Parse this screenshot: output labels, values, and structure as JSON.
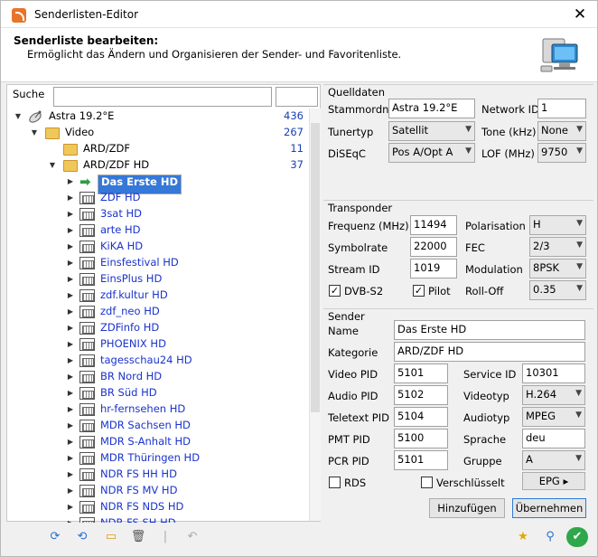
{
  "window": {
    "title": "Senderlisten-Editor",
    "close_glyph": "✕"
  },
  "header": {
    "title": "Senderliste bearbeiten:",
    "subtitle": "Ermöglicht das Ändern und Organisieren der Sender- und Favoritenliste."
  },
  "search": {
    "label": "Suche",
    "value": "",
    "value2": ""
  },
  "tree": {
    "satellite": {
      "label": "Astra 19.2°E",
      "count": "436"
    },
    "video": {
      "label": "Video",
      "count": "267"
    },
    "folders": [
      {
        "label": "ARD/ZDF",
        "count": "11"
      },
      {
        "label": "ARD/ZDF HD",
        "count": "37"
      }
    ],
    "channels": [
      "Das Erste HD",
      "ZDF HD",
      "3sat HD",
      "arte HD",
      "KiKA HD",
      "Einsfestival HD",
      "EinsPlus HD",
      "zdf.kultur HD",
      "zdf_neo HD",
      "ZDFinfo HD",
      "PHOENIX HD",
      "tagesschau24 HD",
      "BR Nord HD",
      "BR Süd HD",
      "hr-fernsehen HD",
      "MDR Sachsen HD",
      "MDR S-Anhalt HD",
      "MDR Thüringen HD",
      "NDR FS HH HD",
      "NDR FS MV HD",
      "NDR FS NDS HD",
      "NDR FS SH HD"
    ]
  },
  "quelldaten": {
    "title": "Quelldaten",
    "stammordner_label": "Stammordner",
    "stammordner_value": "Astra 19.2°E",
    "networkid_label": "Network ID",
    "networkid_value": "1",
    "tunertyp_label": "Tunertyp",
    "tunertyp_value": "Satellit",
    "tone_label": "Tone (kHz)",
    "tone_value": "None",
    "diseqc_label": "DiSEqC",
    "diseqc_value": "Pos A/Opt A",
    "lof_label": "LOF  (MHz)",
    "lof_value": "9750"
  },
  "transponder": {
    "title": "Transponder",
    "frequenz_label": "Frequenz (MHz)",
    "frequenz_value": "11494",
    "polarisation_label": "Polarisation",
    "polarisation_value": "H",
    "symbolrate_label": "Symbolrate",
    "symbolrate_value": "22000",
    "fec_label": "FEC",
    "fec_value": "2/3",
    "streamid_label": "Stream ID",
    "streamid_value": "1019",
    "modulation_label": "Modulation",
    "modulation_value": "8PSK",
    "dvbs2_label": "DVB-S2",
    "pilot_label": "Pilot",
    "rolloff_label": "Roll-Off",
    "rolloff_value": "0.35"
  },
  "sender": {
    "title": "Sender",
    "name_label": "Name",
    "name_value": "Das Erste HD",
    "kategorie_label": "Kategorie",
    "kategorie_value": "ARD/ZDF HD",
    "videopid_label": "Video PID",
    "videopid_value": "5101",
    "serviceid_label": "Service ID",
    "serviceid_value": "10301",
    "audiopid_label": "Audio PID",
    "audiopid_value": "5102",
    "videotyp_label": "Videotyp",
    "videotyp_value": "H.264",
    "teletextpid_label": "Teletext PID",
    "teletextpid_value": "5104",
    "audiotyp_label": "Audiotyp",
    "audiotyp_value": "MPEG",
    "pmtpid_label": "PMT PID",
    "pmtpid_value": "5100",
    "sprache_label": "Sprache",
    "sprache_value": "deu",
    "pcrpid_label": "PCR PID",
    "pcrpid_value": "5101",
    "gruppe_label": "Gruppe",
    "gruppe_value": "A",
    "rds_label": "RDS",
    "verschluesselt_label": "Verschlüsselt",
    "epg_label": "EPG ▸"
  },
  "buttons": {
    "hinzufuegen": "Hinzufügen",
    "uebernehmen": "Übernehmen"
  },
  "colors": {
    "selection": "#3578d8",
    "channel_text": "#1a33cc",
    "count_text": "#1a3fb5"
  }
}
